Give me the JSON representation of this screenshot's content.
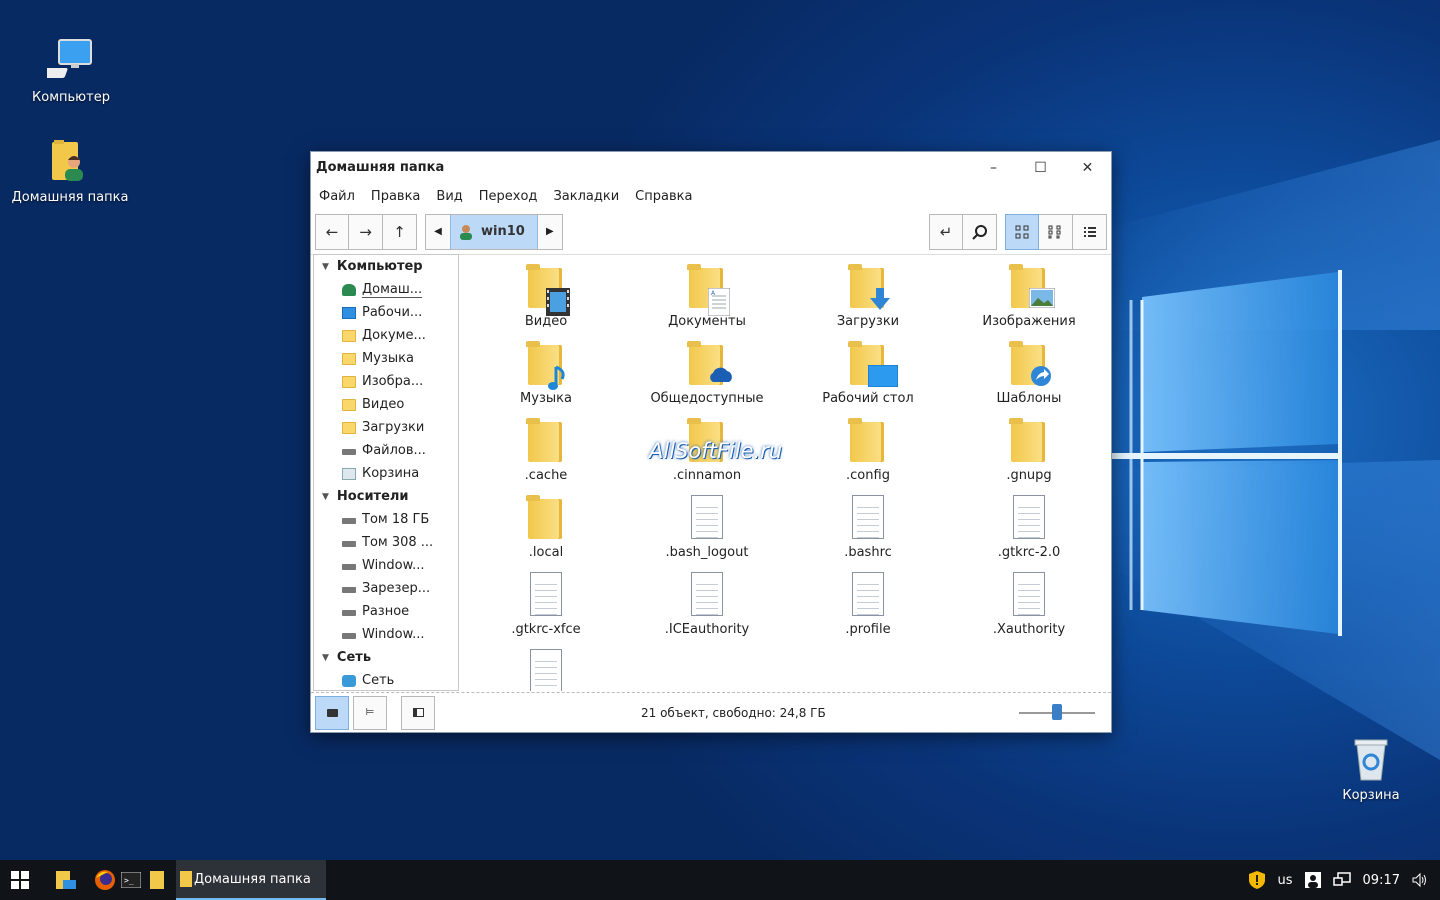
{
  "desktop": {
    "icons": [
      {
        "label": "Компьютер",
        "icon": "computer-icon"
      },
      {
        "label": "Домашняя папка",
        "icon": "home-folder-icon"
      },
      {
        "label": "Корзина",
        "icon": "trash-icon"
      }
    ]
  },
  "window": {
    "title": "Домашняя папка",
    "controls": {
      "minimize": "–",
      "maximize": "☐",
      "close": "✕"
    },
    "menu": [
      "Файл",
      "Правка",
      "Вид",
      "Переход",
      "Закладки",
      "Справка"
    ],
    "toolbar": {
      "back": "←",
      "forward": "→",
      "up": "↑",
      "path": "win10"
    },
    "sidebar": {
      "sections": [
        {
          "title": "Компьютер",
          "items": [
            "Домаш...",
            "Рабочи...",
            "Докуме...",
            "Музыка",
            "Изобра...",
            "Видео",
            "Загрузки",
            "Файлов...",
            "Корзина"
          ]
        },
        {
          "title": "Носители",
          "items": [
            "Том 18 ГБ",
            "Том 308 ...",
            "Window...",
            "Зарезер...",
            "Разное",
            "Window..."
          ]
        },
        {
          "title": "Сеть",
          "items": [
            "Сеть"
          ]
        }
      ]
    },
    "files": [
      {
        "name": "Видео",
        "type": "folder",
        "badge": "video"
      },
      {
        "name": "Документы",
        "type": "folder",
        "badge": "doc"
      },
      {
        "name": "Загрузки",
        "type": "folder",
        "badge": "download"
      },
      {
        "name": "Изображения",
        "type": "folder",
        "badge": "image"
      },
      {
        "name": "Музыка",
        "type": "folder",
        "badge": "music"
      },
      {
        "name": "Общедоступные",
        "type": "folder",
        "badge": "cloud"
      },
      {
        "name": "Рабочий стол",
        "type": "folder",
        "badge": "desktop"
      },
      {
        "name": "Шаблоны",
        "type": "folder",
        "badge": "link"
      },
      {
        "name": ".cache",
        "type": "folder"
      },
      {
        "name": ".cinnamon",
        "type": "folder"
      },
      {
        "name": ".config",
        "type": "folder"
      },
      {
        "name": ".gnupg",
        "type": "folder"
      },
      {
        "name": ".local",
        "type": "folder"
      },
      {
        "name": ".bash_logout",
        "type": "text"
      },
      {
        "name": ".bashrc",
        "type": "text"
      },
      {
        "name": ".gtkrc-2.0",
        "type": "text"
      },
      {
        "name": ".gtkrc-xfce",
        "type": "text"
      },
      {
        "name": ".ICEauthority",
        "type": "text"
      },
      {
        "name": ".profile",
        "type": "text"
      },
      {
        "name": ".Xauthority",
        "type": "text"
      },
      {
        "name": "",
        "type": "text"
      }
    ],
    "status": "21 объект, свободно: 24,8 ГБ",
    "zoom_level": 0.5,
    "watermark": "AllSoftFile.ru"
  },
  "taskbar": {
    "task_label": "Домашняя папка",
    "keyboard": "us",
    "time": "09:17"
  },
  "colors": {
    "accent": "#bcd9f7",
    "taskbar": "#101418",
    "folder": "#f2c84b"
  }
}
